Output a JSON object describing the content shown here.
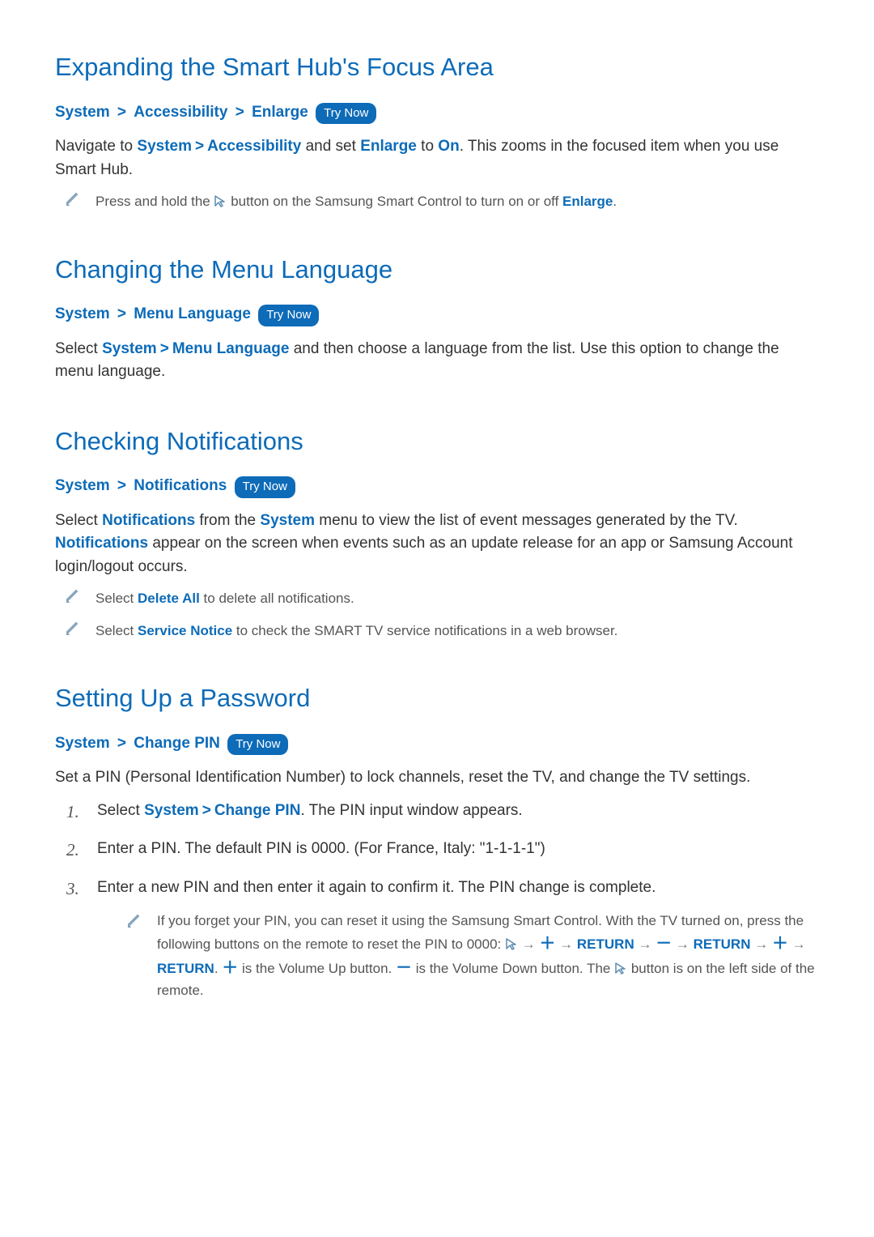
{
  "sections": {
    "expand": {
      "title": "Expanding the Smart Hub's Focus Area",
      "nav": {
        "p1": "System",
        "p2": "Accessibility",
        "p3": "Enlarge",
        "try": "Try Now"
      },
      "body_pre": "Navigate to ",
      "body_nav1": "System",
      "body_nav2": "Accessibility",
      "body_and_set": " and set ",
      "body_enlarge": "Enlarge",
      "body_to": " to ",
      "body_on": "On",
      "body_rest": ". This zooms in the focused item when you use Smart Hub.",
      "note_pre": "Press and hold the ",
      "note_post": " button on the Samsung Smart Control to turn on or off ",
      "note_enlarge": "Enlarge",
      "note_end": "."
    },
    "lang": {
      "title": "Changing the Menu Language",
      "nav": {
        "p1": "System",
        "p2": "Menu Language",
        "try": "Try Now"
      },
      "body_pre": "Select ",
      "body_nav1": "System",
      "body_nav2": "Menu Language",
      "body_rest": " and then choose a language from the list. Use this option to change the menu language."
    },
    "notif": {
      "title": "Checking Notifications",
      "nav": {
        "p1": "System",
        "p2": "Notifications",
        "try": "Try Now"
      },
      "body_pre": "Select ",
      "body_notif": "Notifications",
      "body_mid1": " from the ",
      "body_sys": "System",
      "body_mid2": " menu to view the list of event messages generated by the TV. ",
      "body_notif2": "Notifications",
      "body_rest": " appear on the screen when events such as an update release for an app or Samsung Account login/logout occurs.",
      "note1_pre": "Select ",
      "note1_del": "Delete All",
      "note1_post": " to delete all notifications.",
      "note2_pre": "Select ",
      "note2_sn": "Service Notice",
      "note2_post": " to check the SMART TV service notifications in a web browser."
    },
    "pwd": {
      "title": "Setting Up a Password",
      "nav": {
        "p1": "System",
        "p2": "Change PIN",
        "try": "Try Now"
      },
      "body": "Set a PIN (Personal Identification Number) to lock channels, reset the TV, and change the TV settings.",
      "step1_num": "1.",
      "step1_pre": "Select ",
      "step1_nav1": "System",
      "step1_nav2": "Change PIN",
      "step1_post": ". The PIN input window appears.",
      "step2_num": "2.",
      "step2": "Enter a PIN. The default PIN is 0000. (For France, Italy: \"1-1-1-1\")",
      "step3_num": "3.",
      "step3": "Enter a new PIN and then enter it again to confirm it. The PIN change is complete.",
      "sub_pre": "If you forget your PIN, you can reset it using the Samsung Smart Control. With the TV turned on, press the following buttons on the remote to reset the PIN to 0000: ",
      "sub_arrow": " → ",
      "sub_plus": "＋",
      "sub_ret": "RETURN",
      "sub_minus": "－",
      "sub_mid1": ". ",
      "sub_mid2": " is the Volume Up button. ",
      "sub_mid3": " is the Volume Down button. The ",
      "sub_end": " button is on the left side of the remote."
    }
  },
  "chevron": ">"
}
